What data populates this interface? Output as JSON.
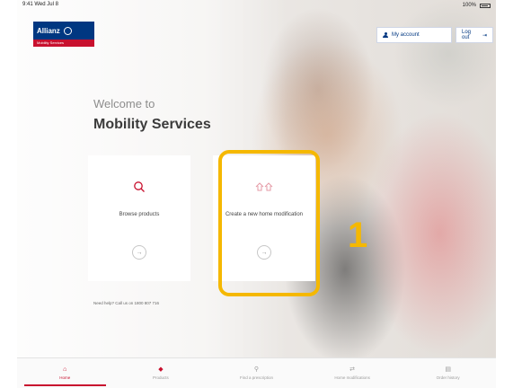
{
  "status_bar": {
    "left": "9:41 Wed Jul 8",
    "right": "100%"
  },
  "logo": {
    "brand": "Allianz",
    "tagline": "Mobility Services"
  },
  "header": {
    "account_label": "My account",
    "login_label": "Log out"
  },
  "main": {
    "welcome": "Welcome to",
    "title": "Mobility Services",
    "cards": [
      {
        "label": "Browse products",
        "icon": "search-icon"
      },
      {
        "label": "Create a new home modification",
        "icon": "home-modification-icon"
      }
    ],
    "phone_text": "Need help? Call us on 1800 807 716"
  },
  "annotation": {
    "number": "1",
    "color": "#f5b800"
  },
  "tabs": [
    {
      "label": "Home",
      "icon": "home-icon",
      "active": true
    },
    {
      "label": "Products",
      "icon": "products-icon",
      "active": false
    },
    {
      "label": "Find a prescription",
      "icon": "prescription-icon",
      "active": false
    },
    {
      "label": "Home modifications",
      "icon": "modifications-icon",
      "active": false
    },
    {
      "label": "Order history",
      "icon": "history-icon",
      "active": false
    }
  ],
  "colors": {
    "brand_blue": "#003781",
    "brand_red": "#c8102e",
    "highlight": "#f5b800"
  }
}
